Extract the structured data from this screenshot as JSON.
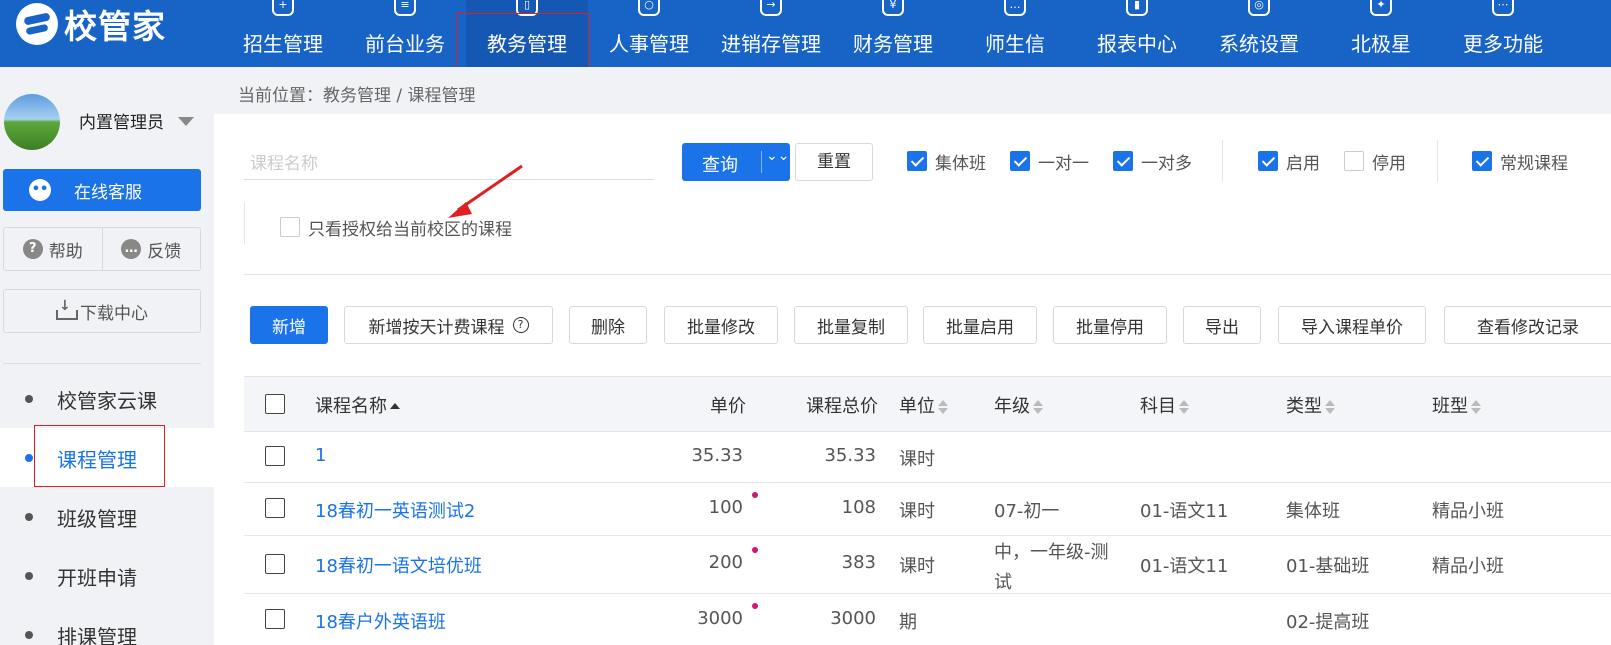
{
  "app": {
    "logo_text": "校管家",
    "nav": [
      {
        "label": "招生管理",
        "icon": "user-add-icon",
        "glyph": "+"
      },
      {
        "label": "前台业务",
        "icon": "desk-icon",
        "glyph": "≡"
      },
      {
        "label": "教务管理",
        "icon": "book-icon",
        "glyph": "▯",
        "active": true
      },
      {
        "label": "人事管理",
        "icon": "person-icon",
        "glyph": "○"
      },
      {
        "label": "进销存管理",
        "icon": "inventory-icon",
        "glyph": "→"
      },
      {
        "label": "财务管理",
        "icon": "finance-icon",
        "glyph": "¥"
      },
      {
        "label": "师生信",
        "icon": "message-icon",
        "glyph": "…"
      },
      {
        "label": "报表中心",
        "icon": "report-icon",
        "glyph": "▮"
      },
      {
        "label": "系统设置",
        "icon": "settings-icon",
        "glyph": "◎"
      },
      {
        "label": "北极星",
        "icon": "star-icon",
        "glyph": "✦"
      },
      {
        "label": "更多功能",
        "icon": "more-icon",
        "glyph": "⋯"
      }
    ]
  },
  "sidebar": {
    "user_name": "内置管理员",
    "online_service": "在线客服",
    "help": "帮助",
    "feedback": "反馈",
    "download_center": "下载中心",
    "menu": [
      {
        "label": "校管家云课"
      },
      {
        "label": "课程管理",
        "active": true
      },
      {
        "label": "班级管理"
      },
      {
        "label": "开班申请"
      },
      {
        "label": "排课管理"
      }
    ]
  },
  "breadcrumb": "当前位置：教务管理 / 课程管理",
  "filters": {
    "search_placeholder": "课程名称",
    "query": "查询",
    "reset": "重置",
    "checkboxes": [
      {
        "label": "集体班",
        "checked": true
      },
      {
        "label": "一对一",
        "checked": true
      },
      {
        "label": "一对多",
        "checked": true
      },
      {
        "label": "启用",
        "checked": true
      },
      {
        "label": "停用",
        "checked": false
      },
      {
        "label": "常规课程",
        "checked": true
      }
    ],
    "authorized_only": {
      "label": "只看授权给当前校区的课程",
      "checked": false
    }
  },
  "toolbar": {
    "add": "新增",
    "add_daily": "新增按天计费课程",
    "delete": "删除",
    "batch_edit": "批量修改",
    "batch_copy": "批量复制",
    "batch_enable": "批量启用",
    "batch_disable": "批量停用",
    "export": "导出",
    "import_price": "导入课程单价",
    "view_history": "查看修改记录"
  },
  "table": {
    "headers": {
      "name": "课程名称",
      "price": "单价",
      "total": "课程总价",
      "unit": "单位",
      "grade": "年级",
      "subject": "科目",
      "type": "类型",
      "class_type": "班型"
    },
    "rows": [
      {
        "name": "1",
        "price": "35.33",
        "total": "35.33",
        "unit": "课时",
        "grade": "",
        "grade2": "",
        "subject": "",
        "type": "",
        "class_type": "",
        "flag": false
      },
      {
        "name": "18春初一英语测试2",
        "price": "100",
        "total": "108",
        "unit": "课时",
        "grade": "07-初一",
        "grade2": "",
        "subject": "01-语文11",
        "type": "集体班",
        "class_type": "精品小班",
        "flag": true
      },
      {
        "name": "18春初一语文培优班",
        "price": "200",
        "total": "383",
        "unit": "课时",
        "grade": "中，一年级-测",
        "grade2": "试",
        "subject": "01-语文11",
        "type": "01-基础班",
        "class_type": "精品小班",
        "flag": true
      },
      {
        "name": "18春户外英语班",
        "price": "3000",
        "total": "3000",
        "unit": "期",
        "grade": "",
        "grade2": "",
        "subject": "",
        "type": "02-提高班",
        "class_type": "",
        "flag": true
      }
    ]
  },
  "colors": {
    "primary": "#1a73e8",
    "topbar": "#1763c6",
    "annotation": "#e02020",
    "flag": "#d4146e"
  }
}
